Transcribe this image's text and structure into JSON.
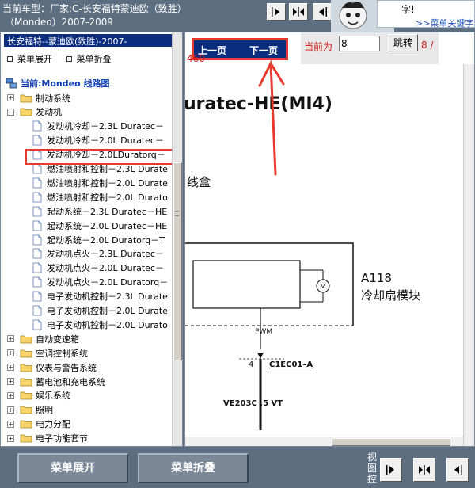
{
  "header": {
    "vehicle_line1": "当前车型：厂家:C-长安福特蒙迪欧（致胜）",
    "vehicle_line2": "（Mondeo）2007-2009",
    "hint_text": "字!",
    "hint_link": ">>菜单关键字"
  },
  "menu": {
    "title": "长安福特--蒙迪欧(致胜)-2007-",
    "expand_label": "菜单展开",
    "collapse_label": "菜单折叠",
    "current_root": "当前:Mondeo 线路图",
    "tree": [
      {
        "label": "制动系统",
        "type": "folder",
        "expander": "+"
      },
      {
        "label": "发动机",
        "type": "folder",
        "expander": "-"
      },
      {
        "label": "发动机冷却－2.3L Duratec－",
        "type": "doc",
        "selected": true
      },
      {
        "label": "发动机冷却－2.0L Duratec－",
        "type": "doc"
      },
      {
        "label": "发动机冷却－2.0LDuratorq－",
        "type": "doc"
      },
      {
        "label": "燃油喷射和控制－2.3L Durate",
        "type": "doc"
      },
      {
        "label": "燃油喷射和控制－2.0L Durate",
        "type": "doc"
      },
      {
        "label": "燃油喷射和控制－2.0L Durato",
        "type": "doc"
      },
      {
        "label": "起动系统－2.3L Duratec－HE",
        "type": "doc"
      },
      {
        "label": "起动系统－2.0L Duratec－HE",
        "type": "doc"
      },
      {
        "label": "起动系统－2.0L Duratorq－T",
        "type": "doc"
      },
      {
        "label": "发动机点火－2.3L Duratec－",
        "type": "doc"
      },
      {
        "label": "发动机点火－2.0L Duratec－",
        "type": "doc"
      },
      {
        "label": "发动机点火－2.0L Duratorq－",
        "type": "doc"
      },
      {
        "label": "电子发动机控制－2.3L Durate",
        "type": "doc"
      },
      {
        "label": "电子发动机控制－2.0L Durate",
        "type": "doc"
      },
      {
        "label": "电子发动机控制－2.0L Durato",
        "type": "doc"
      },
      {
        "label": "自动变速箱",
        "type": "folder",
        "expander": "+"
      },
      {
        "label": "空调控制系统",
        "type": "folder",
        "expander": "+"
      },
      {
        "label": "仪表与警告系统",
        "type": "folder",
        "expander": "+"
      },
      {
        "label": "蓄电池和充电系统",
        "type": "folder",
        "expander": "+"
      },
      {
        "label": "娱乐系统",
        "type": "folder",
        "expander": "+"
      },
      {
        "label": "照明",
        "type": "folder",
        "expander": "+"
      },
      {
        "label": "电力分配",
        "type": "folder",
        "expander": "+"
      },
      {
        "label": "电子功能套节",
        "type": "folder",
        "expander": "+"
      }
    ]
  },
  "toolbar": {
    "prev_page": "上一页",
    "next_page": "下一页",
    "current_label": "当前为",
    "page_value": "8",
    "jump_label": "跳转",
    "total_pages_a": "8 /",
    "total_pages_b": "460"
  },
  "diagram": {
    "title": "uratec-HE(MI4)",
    "subtitle": "线盒",
    "module_code": "A118",
    "module_name": "冷却扇模块",
    "pwm": "PWM",
    "pin": "4",
    "connector": "C1EC01–A",
    "wire": "VE203C  .5 VT"
  },
  "bottom": {
    "expand_button": "菜单展开",
    "collapse_button": "菜单折叠",
    "view_ctrl_label": "视图控"
  },
  "colors": {
    "accent_red": "#e8392f",
    "nav_blue": "#0a2d80",
    "chrome": "#5c6e80"
  }
}
